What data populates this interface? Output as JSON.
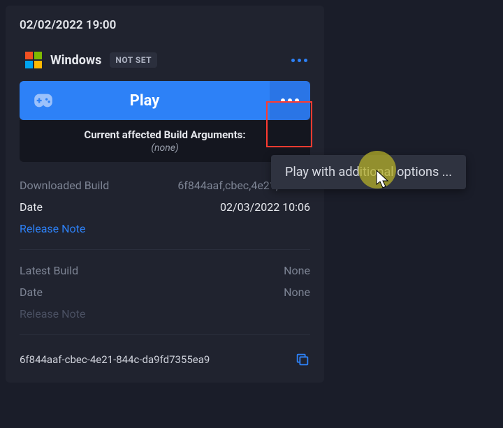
{
  "timestamp": "02/02/2022 19:00",
  "platform": {
    "name": "Windows",
    "status_badge": "NOT SET"
  },
  "play": {
    "label": "Play"
  },
  "build_args": {
    "title": "Current affected Build Arguments:",
    "value": "(none)"
  },
  "downloaded": {
    "build_label": "Downloaded Build",
    "build_value": "6f844aaf,cbec,4e21,844c…",
    "date_label": "Date",
    "date_value": "02/03/2022 10:06",
    "release_note_label": "Release Note"
  },
  "latest": {
    "build_label": "Latest Build",
    "build_value": "None",
    "date_label": "Date",
    "date_value": "None",
    "release_note_label": "Release Note"
  },
  "footer": {
    "guid": "6f844aaf-cbec-4e21-844c-da9fd7355ea9"
  },
  "tooltip": {
    "text": "Play with additional options ..."
  }
}
